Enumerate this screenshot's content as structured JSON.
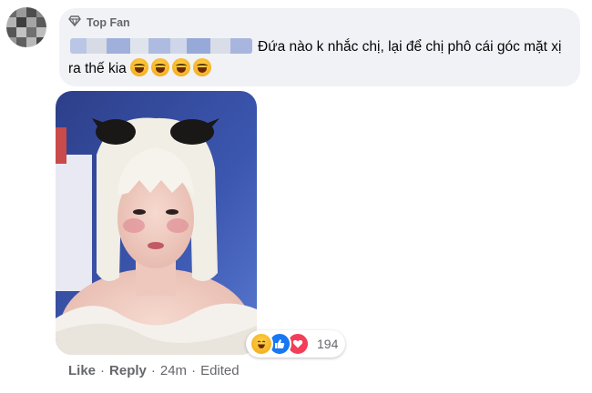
{
  "comment": {
    "badge_label": "Top Fan",
    "text": "Đứa nào k nhắc chị, lại để chị phô cái góc mặt xị ra thế kia",
    "emoji_name": "laughing-emoji",
    "emoji_count": 4
  },
  "reactions": {
    "icons": [
      "haha",
      "like",
      "love"
    ],
    "count": "194"
  },
  "actions": {
    "like": "Like",
    "reply": "Reply",
    "time": "24m",
    "edited": "Edited",
    "separator": "·"
  },
  "colors": {
    "bubble": "#f0f2f5",
    "secondary_text": "#65676b",
    "like_blue": "#1877f2",
    "love_red": "#f33e58"
  }
}
